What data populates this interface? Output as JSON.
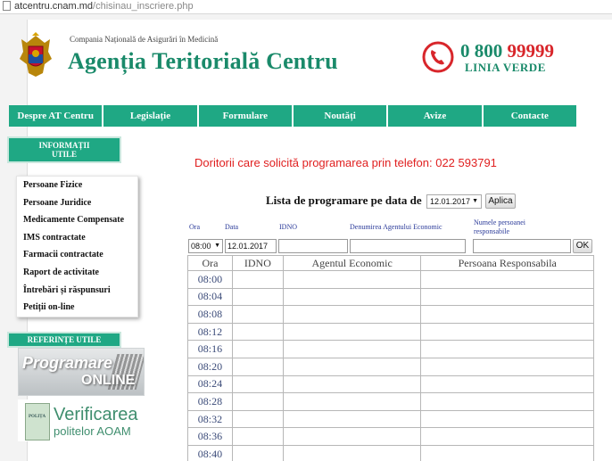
{
  "browser": {
    "url_host": "atcentru.cnam.md",
    "url_path": "/chisinau_inscriere.php"
  },
  "header": {
    "company": "Compania Națională de Asigurări în Medicină",
    "agency": "Agenția Teritorială Centru",
    "phone_prefix": "0 800",
    "phone_number": "99999",
    "phone_line": "LINIA VERDE"
  },
  "nav": [
    "Despre AT Centru",
    "Legislație",
    "Formulare",
    "Noutăți",
    "Avize",
    "Contacte"
  ],
  "sidebar": {
    "info_title_1": "INFORMAȚII",
    "info_title_2": "UTILE",
    "items": [
      "Persoane Fizice",
      "Persoane Juridice",
      "Medicamente Compensate",
      "IMS contractate",
      "Farmacii contractate",
      "Raport de activitate",
      "Întrebări și răspunsuri",
      "Petiții on-line"
    ],
    "ref_title": "REFERINȚE UTILE",
    "banner_programare": "Programare",
    "banner_online": "ONLINE",
    "banner_polita": "POLIȚA",
    "banner_verificarea": "Verificarea",
    "banner_politelor": "politelor AOAM"
  },
  "main": {
    "notice": "Doritorii care solicită programarea prin telefon: 022 593791",
    "list_title": "Lista de programare pe data de",
    "selected_date": "12.01.2017",
    "aplica_label": "Aplica",
    "filters": {
      "ora_label": "Ora",
      "data_label": "Data",
      "idno_label": "IDNO",
      "agent_label": "Denumirea Agentului Economic",
      "person_label_1": "Numele persoanei",
      "person_label_2": "responsabile",
      "ora_value": "08:00",
      "data_value": "12.01.2017",
      "ok_label": "OK"
    },
    "table": {
      "headers": [
        "Ora",
        "IDNO",
        "Agentul Economic",
        "Persoana Responsabila"
      ],
      "times": [
        "08:00",
        "08:04",
        "08:08",
        "08:12",
        "08:16",
        "08:20",
        "08:24",
        "08:28",
        "08:32",
        "08:36",
        "08:40"
      ]
    }
  },
  "colors": {
    "brand_green": "#1fa884",
    "agency_green": "#1a8a6a",
    "alert_red": "#e02020",
    "phone_red": "#d8262b"
  }
}
